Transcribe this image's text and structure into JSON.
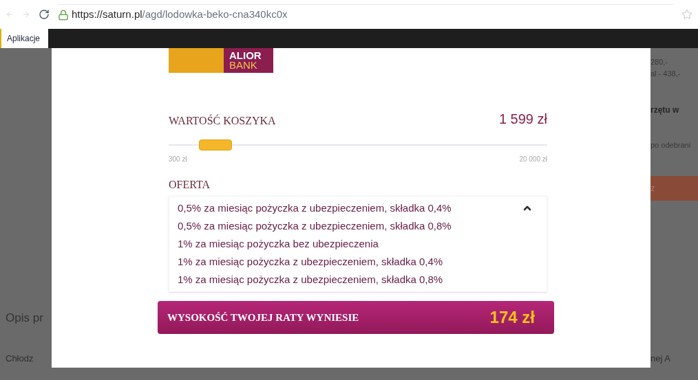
{
  "browser": {
    "url_host": "https://saturn.pl",
    "url_path": "/agd/lodowka-beko-cna340kc0x",
    "bookmarks": [
      "Aplikacje"
    ]
  },
  "background_page": {
    "right_texts": [
      "280,-",
      "al - 438,-",
      "rzętu w",
      "po odebrani"
    ],
    "right_button": "z",
    "left_heading": "Opis pr",
    "left_text": "Chłodz",
    "right_bottom_text": "nej A"
  },
  "modal": {
    "logo": {
      "line1": "ALIOR",
      "line2": "BANK"
    },
    "basket": {
      "label": "WARTOŚĆ KOSZYKA",
      "value": "1 599 zł",
      "slider": {
        "level": 0.08,
        "min_label": "300 zł",
        "max_label": "20 000 zł"
      }
    },
    "offer": {
      "label": "OFERTA",
      "options": [
        "0,5% za miesiąc pożyczka z ubezpieczeniem, składka 0,4%",
        "0,5% za miesiąc pożyczka z ubezpieczeniem, składka 0,8%",
        "1% za miesiąc pożyczka bez ubezpieczenia",
        "1% za miesiąc pożyczka z ubezpieczeniem, składka 0,4%",
        "1% za miesiąc pożyczka z ubezpieczeniem, składka 0,8%"
      ]
    },
    "result": {
      "label": "WYSOKOŚĆ TWOJEJ RATY WYNIESIE",
      "value": "174 zł"
    }
  }
}
